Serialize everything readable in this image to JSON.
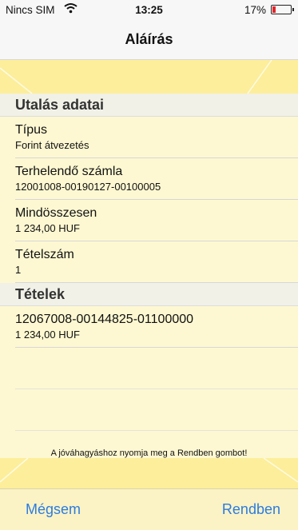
{
  "status_bar": {
    "carrier": "Nincs SIM",
    "time": "13:25",
    "battery_percent": "17%",
    "battery_level": 0.17,
    "wifi_icon": "wifi-icon",
    "battery_icon": "battery-icon",
    "battery_color": "#e0262b"
  },
  "nav": {
    "title": "Aláírás"
  },
  "section_details": {
    "title": "Utalás adatai",
    "rows": [
      {
        "label": "Típus",
        "value": "Forint átvezetés"
      },
      {
        "label": "Terhelendő számla",
        "value": "12001008-00190127-00100005"
      },
      {
        "label": "Mindösszesen",
        "value": "1 234,00 HUF"
      },
      {
        "label": "Tételszám",
        "value": "1"
      }
    ]
  },
  "section_items": {
    "title": "Tételek",
    "rows": [
      {
        "label": "12067008-00144825-01100000",
        "value": "1 234,00 HUF"
      }
    ]
  },
  "hint": "A jóváhagyáshoz nyomja meg a Rendben gombot!",
  "toolbar": {
    "cancel_label": "Mégsem",
    "ok_label": "Rendben"
  },
  "colors": {
    "accent": "#2c7be0",
    "band": "#fcee9b",
    "background": "#fdf8d2"
  }
}
